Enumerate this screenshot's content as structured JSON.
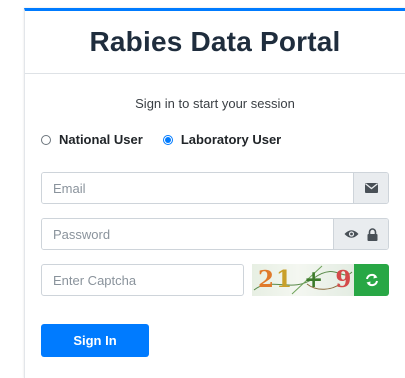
{
  "header": {
    "title": "Rabies Data Portal"
  },
  "login": {
    "message": "Sign in to start your session"
  },
  "user_type": {
    "options": [
      {
        "label": "National User",
        "selected": false
      },
      {
        "label": "Laboratory User",
        "selected": true
      }
    ]
  },
  "fields": {
    "email": {
      "placeholder": "Email",
      "value": ""
    },
    "password": {
      "placeholder": "Password",
      "value": ""
    },
    "captcha": {
      "placeholder": "Enter Captcha",
      "value": ""
    }
  },
  "captcha_image": {
    "glyphs": [
      {
        "ch": "2",
        "color": "#e07a2b"
      },
      {
        "ch": "1",
        "color": "#c9a02a"
      },
      {
        "ch": "+",
        "color": "#3c7a2a"
      },
      {
        "ch": "9",
        "color": "#d44a4a"
      }
    ]
  },
  "buttons": {
    "signin": "Sign In"
  },
  "icons": {
    "email": "envelope-icon",
    "password_toggle": "eye-icon",
    "password_lock": "lock-icon",
    "refresh": "refresh-icon"
  },
  "colors": {
    "primary": "#007bff",
    "success": "#28a745"
  }
}
